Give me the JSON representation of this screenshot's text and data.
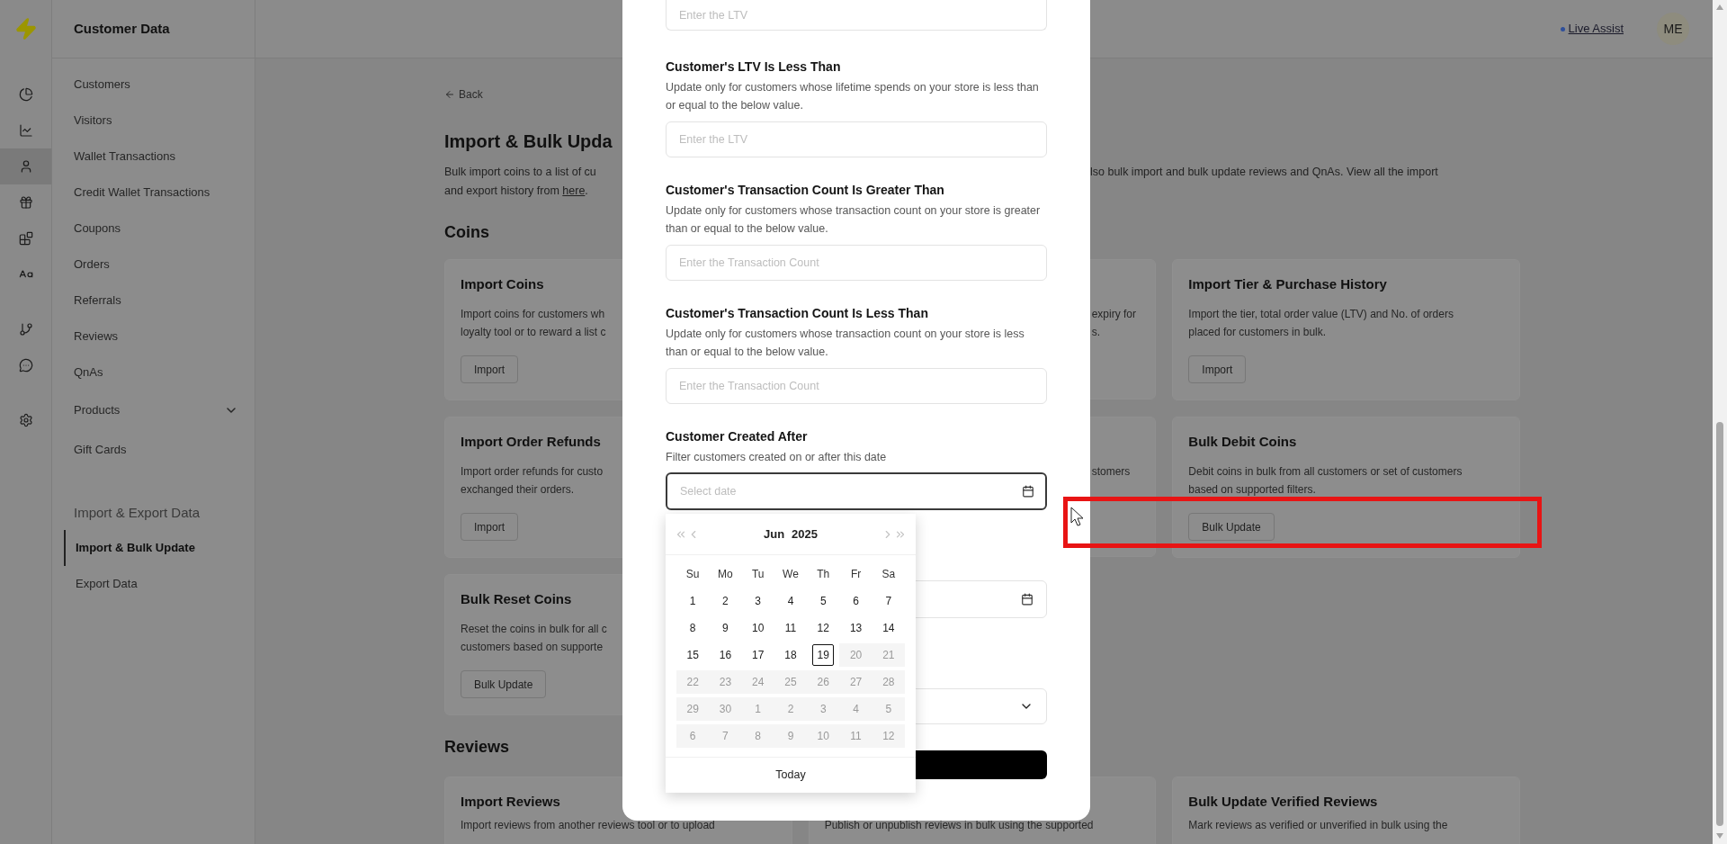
{
  "rail": [
    [
      {
        "kind": "logo",
        "selected": false
      }
    ],
    [
      {
        "kind": "pie",
        "selected": false
      },
      {
        "kind": "chart",
        "selected": false
      },
      {
        "kind": "user",
        "selected": true
      },
      {
        "kind": "gift",
        "selected": false
      },
      {
        "kind": "blocks",
        "selected": false
      },
      {
        "kind": "text",
        "selected": false
      }
    ],
    [
      {
        "kind": "branch",
        "selected": false
      },
      {
        "kind": "chat",
        "selected": false
      }
    ],
    [
      {
        "kind": "settings",
        "selected": false
      }
    ]
  ],
  "sidebar": {
    "title": "Customer Data",
    "items": [
      {
        "label": "Customers",
        "kind": "link"
      },
      {
        "label": "Visitors",
        "kind": "link"
      },
      {
        "label": "Wallet Transactions",
        "kind": "link"
      },
      {
        "label": "Credit Wallet Transactions",
        "kind": "link"
      },
      {
        "label": "Coupons",
        "kind": "link"
      },
      {
        "label": "Orders",
        "kind": "link"
      },
      {
        "label": "Referrals",
        "kind": "link"
      },
      {
        "label": "Reviews",
        "kind": "link"
      },
      {
        "label": "QnAs",
        "kind": "link"
      },
      {
        "label": "Products",
        "kind": "group",
        "expanded": false
      },
      {
        "label": "Gift Cards",
        "kind": "link"
      }
    ],
    "section": {
      "title": "Import & Export Data",
      "items": [
        {
          "label": "Import & Bulk Update",
          "selected": true
        },
        {
          "label": "Export Data",
          "selected": false
        }
      ]
    }
  },
  "top_bar": {
    "link": "Live Assist",
    "avatar": "ME"
  },
  "page": {
    "back": "Back",
    "title": "Import & Bulk Upda",
    "description_left": "Bulk import coins to a list of cu",
    "description_right": "lso bulk import and bulk update reviews and QnAs. View all the import",
    "description_line2": "and export history from ",
    "description_link": "here",
    "description_end": ".",
    "sections": [
      {
        "title": "Coins",
        "cards": [
          {
            "kind": "full",
            "title": "Import Coins",
            "lines": [
              "Import coins for customers wh",
              "loyalty tool or to reward a list c"
            ],
            "button": "Import"
          },
          {
            "kind": "fragment",
            "lines": [
              "expiry for",
              "s."
            ]
          },
          {
            "kind": "full",
            "title": "Import Tier & Purchase History",
            "lines": [
              "Import the tier, total order value (LTV) and No. of orders",
              "placed for customers in bulk."
            ],
            "button": "Import"
          },
          {
            "kind": "full",
            "title": "Import Order Refunds",
            "lines": [
              "Import order refunds for custo",
              "exchanged their orders."
            ],
            "button": "Import"
          },
          {
            "kind": "fragment",
            "lines": [
              "stomers"
            ]
          },
          {
            "kind": "full",
            "title": "Bulk Debit Coins",
            "lines": [
              "Debit coins in bulk from all customers or set of customers",
              "based on supported filters."
            ],
            "button": "Bulk Update"
          },
          {
            "kind": "full",
            "title": "Bulk Reset Coins",
            "lines": [
              "Reset the coins in bulk for all c",
              "customers based on supporte"
            ],
            "button": "Bulk Update"
          }
        ]
      },
      {
        "title": "Reviews",
        "cards": [
          {
            "kind": "full",
            "title": "Import Reviews",
            "lines": [
              "Import reviews from another reviews tool or to upload"
            ]
          },
          {
            "kind": "lower",
            "lines": [
              "Publish or unpublish reviews in bulk using the supported"
            ]
          },
          {
            "kind": "full",
            "title": "Bulk Update Verified Reviews",
            "lines": [
              "Mark reviews as verified or unverified in bulk using the"
            ]
          }
        ]
      }
    ]
  },
  "modal": {
    "top_field": {
      "placeholder": "Enter the LTV"
    },
    "filters": [
      {
        "label": "Customer's LTV Is Less Than",
        "description": "Update only for customers whose lifetime spends on your store is less than or equal to the below value.",
        "placeholder": "Enter the LTV"
      },
      {
        "label": "Customer's Transaction Count Is Greater Than",
        "description": "Update only for customers whose transaction count on your store is greater than or equal to the below value.",
        "placeholder": "Enter the Transaction Count"
      },
      {
        "label": "Customer's Transaction Count Is Less Than",
        "description": "Update only for customers whose transaction count on your store is less than or equal to the below value.",
        "placeholder": "Enter the Transaction Count"
      }
    ],
    "date_filter": {
      "label": "Customer Created After",
      "description": "Filter customers created on or after this date",
      "placeholder": "Select date",
      "focused": true
    },
    "calendar": {
      "month": "Jun",
      "year": "2025",
      "weekdays": [
        "Su",
        "Mo",
        "Tu",
        "We",
        "Th",
        "Fr",
        "Sa"
      ],
      "footer": "Today",
      "days": [
        {
          "label": "1",
          "disabled": false,
          "today": false
        },
        {
          "label": "2",
          "disabled": false,
          "today": false
        },
        {
          "label": "3",
          "disabled": false,
          "today": false
        },
        {
          "label": "4",
          "disabled": false,
          "today": false
        },
        {
          "label": "5",
          "disabled": false,
          "today": false
        },
        {
          "label": "6",
          "disabled": false,
          "today": false
        },
        {
          "label": "7",
          "disabled": false,
          "today": false
        },
        {
          "label": "8",
          "disabled": false,
          "today": false
        },
        {
          "label": "9",
          "disabled": false,
          "today": false
        },
        {
          "label": "10",
          "disabled": false,
          "today": false
        },
        {
          "label": "11",
          "disabled": false,
          "today": false
        },
        {
          "label": "12",
          "disabled": false,
          "today": false
        },
        {
          "label": "13",
          "disabled": false,
          "today": false
        },
        {
          "label": "14",
          "disabled": false,
          "today": false
        },
        {
          "label": "15",
          "disabled": false,
          "today": false
        },
        {
          "label": "16",
          "disabled": false,
          "today": false
        },
        {
          "label": "17",
          "disabled": false,
          "today": false
        },
        {
          "label": "18",
          "disabled": false,
          "today": false
        },
        {
          "label": "19",
          "disabled": false,
          "today": true
        },
        {
          "label": "20",
          "disabled": true,
          "today": false
        },
        {
          "label": "21",
          "disabled": true,
          "today": false
        },
        {
          "label": "22",
          "disabled": true,
          "today": false
        },
        {
          "label": "23",
          "disabled": true,
          "today": false
        },
        {
          "label": "24",
          "disabled": true,
          "today": false
        },
        {
          "label": "25",
          "disabled": true,
          "today": false
        },
        {
          "label": "26",
          "disabled": true,
          "today": false
        },
        {
          "label": "27",
          "disabled": true,
          "today": false
        },
        {
          "label": "28",
          "disabled": true,
          "today": false
        },
        {
          "label": "29",
          "disabled": true,
          "today": false
        },
        {
          "label": "30",
          "disabled": true,
          "today": false
        },
        {
          "label": "1",
          "disabled": true,
          "today": false
        },
        {
          "label": "2",
          "disabled": true,
          "today": false
        },
        {
          "label": "3",
          "disabled": true,
          "today": false
        },
        {
          "label": "4",
          "disabled": true,
          "today": false
        },
        {
          "label": "5",
          "disabled": true,
          "today": false
        },
        {
          "label": "6",
          "disabled": true,
          "today": false
        },
        {
          "label": "7",
          "disabled": true,
          "today": false
        },
        {
          "label": "8",
          "disabled": true,
          "today": false
        },
        {
          "label": "9",
          "disabled": true,
          "today": false
        },
        {
          "label": "10",
          "disabled": true,
          "today": false
        },
        {
          "label": "11",
          "disabled": true,
          "today": false
        },
        {
          "label": "12",
          "disabled": true,
          "today": false
        }
      ]
    }
  }
}
